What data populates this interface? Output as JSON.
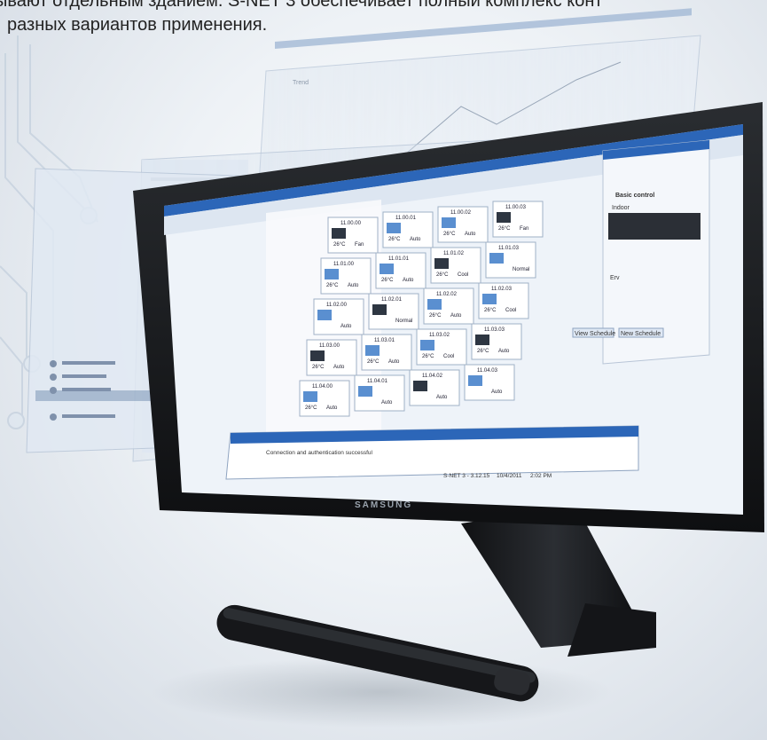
{
  "caption": {
    "line1": "ывают отдельным зданием. S-NET 3 обеспечивает полный комплекс конт",
    "line2": "разных вариантов применения."
  },
  "monitor": {
    "brand": "SAMSUNG"
  },
  "software": {
    "panel_title": "Basic control",
    "indoor_label": "Indoor",
    "erv_label": "Erv",
    "view_schedule": "View Schedule",
    "new_schedule": "New Schedule",
    "status_text": "S-NET 3 - 3.12.15",
    "status_date": "10/4/2011",
    "status_time": "2:02 PM",
    "log_text": "Connection and authentication successful"
  },
  "tiles": [
    {
      "id": "11.00.00",
      "temp": "26°C",
      "mode": "Fan"
    },
    {
      "id": "11.00.01",
      "temp": "26°C",
      "mode": "Auto"
    },
    {
      "id": "11.00.02",
      "temp": "26°C",
      "mode": "Auto"
    },
    {
      "id": "11.00.03",
      "temp": "26°C",
      "mode": "Fan"
    },
    {
      "id": "11.01.00",
      "temp": "26°C",
      "mode": "Auto"
    },
    {
      "id": "11.01.01",
      "temp": "26°C",
      "mode": "Auto"
    },
    {
      "id": "11.01.02",
      "temp": "26°C",
      "mode": "Cool"
    },
    {
      "id": "11.01.03",
      "temp": "",
      "mode": "Normal"
    },
    {
      "id": "11.02.00",
      "temp": "",
      "mode": "Auto"
    },
    {
      "id": "11.02.01",
      "temp": "",
      "mode": "Normal"
    },
    {
      "id": "11.02.02",
      "temp": "26°C",
      "mode": "Auto"
    },
    {
      "id": "11.02.03",
      "temp": "26°C",
      "mode": "Cool"
    },
    {
      "id": "11.03.00",
      "temp": "26°C",
      "mode": "Auto"
    },
    {
      "id": "11.03.01",
      "temp": "26°C",
      "mode": "Auto"
    },
    {
      "id": "11.03.02",
      "temp": "26°C",
      "mode": "Cool"
    },
    {
      "id": "11.03.03",
      "temp": "26°C",
      "mode": "Auto"
    },
    {
      "id": "11.04.00",
      "temp": "26°C",
      "mode": "Auto"
    },
    {
      "id": "11.04.01",
      "temp": "",
      "mode": "Auto"
    },
    {
      "id": "11.04.02",
      "temp": "",
      "mode": "Auto"
    },
    {
      "id": "11.04.03",
      "temp": "",
      "mode": "Auto"
    }
  ],
  "colors": {
    "screen_bg": "#eef3f9",
    "accent_blue": "#2c66b8",
    "bezel": "#1b1d20",
    "highlight_orange": "#f08a1e"
  },
  "icons": [
    "circuit-lines-icon",
    "ac-unit-icon",
    "fan-icon",
    "vent-icon"
  ]
}
